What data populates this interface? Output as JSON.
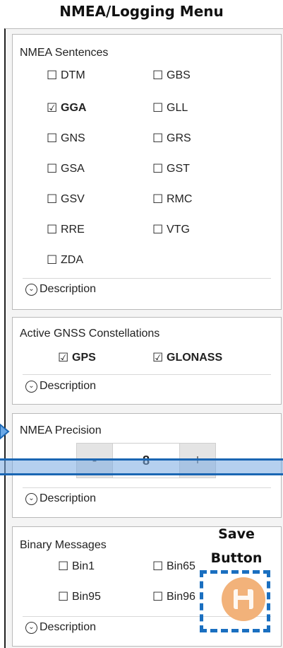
{
  "page_title": "NMEA/Logging Menu",
  "nmea_sentences": {
    "title": "NMEA Sentences",
    "items": [
      {
        "label": "DTM",
        "checked": false
      },
      {
        "label": "GBS",
        "checked": false
      },
      {
        "label": "GGA",
        "checked": true
      },
      {
        "label": "GLL",
        "checked": false
      },
      {
        "label": "GNS",
        "checked": false
      },
      {
        "label": "GRS",
        "checked": false
      },
      {
        "label": "GSA",
        "checked": false
      },
      {
        "label": "GST",
        "checked": false
      },
      {
        "label": "GSV",
        "checked": false
      },
      {
        "label": "RMC",
        "checked": false
      },
      {
        "label": "RRE",
        "checked": false
      },
      {
        "label": "VTG",
        "checked": false
      },
      {
        "label": "ZDA",
        "checked": false
      }
    ],
    "description": "Description"
  },
  "gnss": {
    "title": "Active GNSS Constellations",
    "items": [
      {
        "label": "GPS",
        "checked": true
      },
      {
        "label": "GLONASS",
        "checked": true
      }
    ],
    "description": "Description"
  },
  "precision": {
    "title": "NMEA Precision",
    "minus": "-",
    "value": "8",
    "plus": "+",
    "description": "Description"
  },
  "binary": {
    "title": "Binary Messages",
    "items": [
      {
        "label": "Bin1",
        "checked": false
      },
      {
        "label": "Bin65",
        "checked": false
      },
      {
        "label": "Bin95",
        "checked": false
      },
      {
        "label": "Bin96",
        "checked": false
      }
    ],
    "description": "Description"
  },
  "annotation": {
    "save_line1": "Save",
    "save_line2": "Button"
  },
  "glyphs": {
    "unchecked": "☐",
    "checked": "☑",
    "chevron": "⌄"
  },
  "colors": {
    "highlight": "#1a66b3",
    "save_button": "#f2b27a"
  }
}
